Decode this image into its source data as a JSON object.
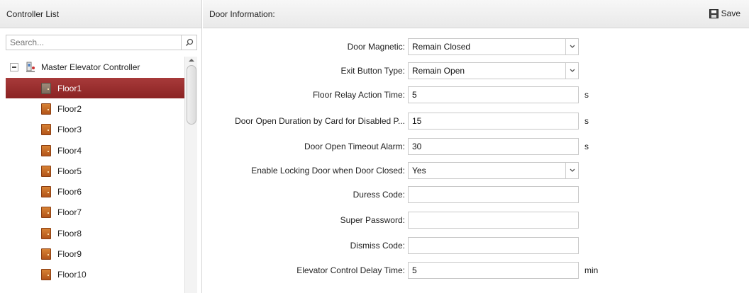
{
  "left_panel": {
    "title": "Controller List",
    "search_placeholder": "Search...",
    "tree": {
      "root_label": "Master Elevator Controller",
      "items": [
        {
          "label": "Floor1",
          "selected": true
        },
        {
          "label": "Floor2"
        },
        {
          "label": "Floor3"
        },
        {
          "label": "Floor4"
        },
        {
          "label": "Floor5"
        },
        {
          "label": "Floor6"
        },
        {
          "label": "Floor7"
        },
        {
          "label": "Floor8"
        },
        {
          "label": "Floor9"
        },
        {
          "label": "Floor10"
        }
      ]
    }
  },
  "right_panel": {
    "title": "Door Information:",
    "save_label": "Save",
    "fields": {
      "door_magnetic": {
        "label": "Door Magnetic:",
        "value": "Remain Closed"
      },
      "exit_button_type": {
        "label": "Exit Button Type:",
        "value": "Remain Open"
      },
      "floor_relay_action_time": {
        "label": "Floor Relay Action Time:",
        "value": "5",
        "unit": "s"
      },
      "door_open_duration": {
        "label": "Door Open Duration by Card for Disabled P...",
        "value": "15",
        "unit": "s"
      },
      "door_open_timeout_alarm": {
        "label": "Door Open Timeout Alarm:",
        "value": "30",
        "unit": "s"
      },
      "enable_locking": {
        "label": "Enable Locking Door when Door Closed:",
        "value": "Yes"
      },
      "duress_code": {
        "label": "Duress Code:",
        "value": ""
      },
      "super_password": {
        "label": "Super Password:",
        "value": ""
      },
      "dismiss_code": {
        "label": "Dismiss Code:",
        "value": ""
      },
      "elevator_control_delay": {
        "label": "Elevator Control Delay Time:",
        "value": "5",
        "unit": "min"
      }
    }
  },
  "colors": {
    "selected_row": "#9a2f2f",
    "header_bg": "#eeeeee",
    "door_icon": "#c8692a"
  },
  "icons": {
    "search": "search-icon",
    "save": "floppy-disk-icon",
    "door": "door-icon",
    "controller": "elevator-controller-icon"
  }
}
